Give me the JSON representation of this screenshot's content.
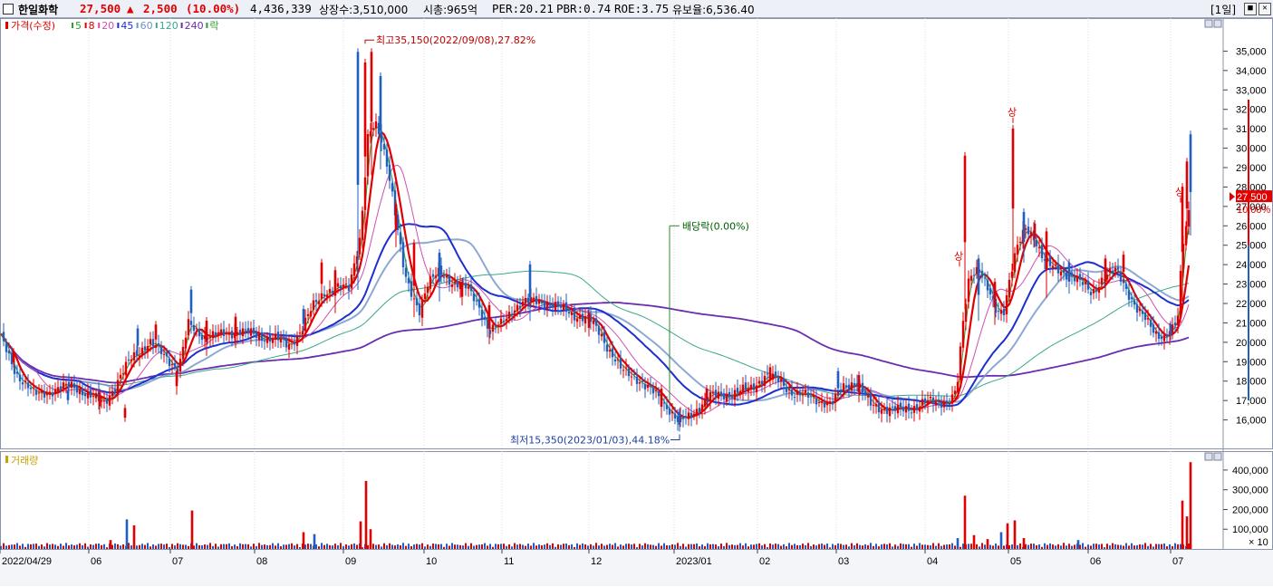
{
  "header": {
    "stock_name": "한일화학",
    "price": "27,500",
    "change_arrow": "▲",
    "change": "2,500",
    "change_pct": "(10.00%)",
    "volume": "4,436,339",
    "listed_shares": "상장수:3,510,000",
    "market_cap": "시총:965억",
    "per": "PER:20.21",
    "pbr": "PBR:0.74",
    "roe": "ROE:3.75",
    "retention": "유보율:6,536.40",
    "period": "[1일]"
  },
  "colors": {
    "up": "#e00000",
    "down": "#1f5fbf",
    "ma5": "#2ca02c",
    "ma8": "#e00000",
    "ma20": "#d050b0",
    "ma45": "#1c2fd0",
    "ma60": "#6f93c8",
    "ma120": "#3aa88a",
    "ma240": "#6a2db0"
  },
  "chart_data": {
    "type": "candlestick",
    "price_panel": {
      "legend": [
        {
          "label": "가격(수정)",
          "color": "#e00000"
        },
        {
          "label": "5",
          "color": "#2ca02c"
        },
        {
          "label": "8",
          "color": "#e00000"
        },
        {
          "label": "20",
          "color": "#d050b0"
        },
        {
          "label": "45",
          "color": "#1c2fd0"
        },
        {
          "label": "60",
          "color": "#6f93c8"
        },
        {
          "label": "120",
          "color": "#3aa88a"
        },
        {
          "label": "240",
          "color": "#6a2db0"
        },
        {
          "label": "락",
          "color": "#2ca02c"
        }
      ],
      "y_ticks": [
        "16,000",
        "17,000",
        "18,000",
        "19,000",
        "20,000",
        "21,000",
        "22,000",
        "23,000",
        "24,000",
        "25,000",
        "26,000",
        "27,000",
        "28,000",
        "29,000",
        "30,000",
        "31,000",
        "32,000",
        "33,000",
        "34,000",
        "35,000"
      ],
      "ylim": [
        15000,
        36000
      ],
      "current_price_label": "27,500",
      "current_pct_label": "10.00%",
      "annotations": {
        "high": "최고35,150(2022/09/08),27.82%",
        "low": "최저15,350(2023/01/03),44.18%",
        "dividend": "배당락(0.00%)",
        "limit_up": "상"
      }
    },
    "volume_panel": {
      "label": "거래량",
      "y_ticks": [
        "100,000",
        "200,000",
        "300,000",
        "400,000"
      ],
      "ylim": [
        0,
        450000
      ],
      "unit": "× 10"
    },
    "x_labels": [
      "2022/04/29",
      "06",
      "07",
      "08",
      "09",
      "10",
      "11",
      "12",
      "2023/01",
      "02",
      "03",
      "04",
      "05",
      "06",
      "07"
    ],
    "keypoints": [
      [
        0,
        20300
      ],
      [
        18,
        18400
      ],
      [
        38,
        17300
      ],
      [
        58,
        17500
      ],
      [
        80,
        17800
      ],
      [
        100,
        17200
      ],
      [
        115,
        16900
      ],
      [
        128,
        17800
      ],
      [
        145,
        19200
      ],
      [
        165,
        20000
      ],
      [
        182,
        19300
      ],
      [
        197,
        18600
      ],
      [
        208,
        20900
      ],
      [
        225,
        20300
      ],
      [
        245,
        20400
      ],
      [
        265,
        20600
      ],
      [
        285,
        20300
      ],
      [
        305,
        20200
      ],
      [
        318,
        19800
      ],
      [
        332,
        20600
      ],
      [
        345,
        21800
      ],
      [
        358,
        22600
      ],
      [
        372,
        22800
      ],
      [
        385,
        22800
      ],
      [
        398,
        25600
      ],
      [
        406,
        30500
      ],
      [
        414,
        31200
      ],
      [
        421,
        30400
      ],
      [
        427,
        29300
      ],
      [
        433,
        27700
      ],
      [
        440,
        25400
      ],
      [
        447,
        23300
      ],
      [
        455,
        22400
      ],
      [
        463,
        21700
      ],
      [
        472,
        23000
      ],
      [
        485,
        23600
      ],
      [
        500,
        23100
      ],
      [
        515,
        22800
      ],
      [
        528,
        22000
      ],
      [
        540,
        20500
      ],
      [
        552,
        20900
      ],
      [
        565,
        21700
      ],
      [
        578,
        22000
      ],
      [
        590,
        22200
      ],
      [
        600,
        22100
      ],
      [
        612,
        21800
      ],
      [
        625,
        21700
      ],
      [
        638,
        21300
      ],
      [
        652,
        21100
      ],
      [
        663,
        20500
      ],
      [
        673,
        19500
      ],
      [
        685,
        18600
      ],
      [
        700,
        18300
      ],
      [
        712,
        17700
      ],
      [
        725,
        17300
      ],
      [
        738,
        16600
      ],
      [
        748,
        15900
      ],
      [
        758,
        16100
      ],
      [
        770,
        16600
      ],
      [
        783,
        17200
      ],
      [
        798,
        17300
      ],
      [
        812,
        17400
      ],
      [
        828,
        17600
      ],
      [
        845,
        18300
      ],
      [
        860,
        18000
      ],
      [
        875,
        17400
      ],
      [
        890,
        17200
      ],
      [
        905,
        17000
      ],
      [
        918,
        16800
      ],
      [
        930,
        17700
      ],
      [
        945,
        18000
      ],
      [
        960,
        16800
      ],
      [
        975,
        16600
      ],
      [
        990,
        16500
      ],
      [
        1005,
        16600
      ],
      [
        1020,
        16900
      ],
      [
        1035,
        16900
      ],
      [
        1048,
        17000
      ],
      [
        1056,
        17500
      ],
      [
        1063,
        21000
      ],
      [
        1070,
        23500
      ],
      [
        1080,
        23900
      ],
      [
        1090,
        22700
      ],
      [
        1100,
        21500
      ],
      [
        1108,
        21700
      ],
      [
        1115,
        23500
      ],
      [
        1122,
        24800
      ],
      [
        1132,
        25800
      ],
      [
        1142,
        25400
      ],
      [
        1152,
        24300
      ],
      [
        1162,
        23800
      ],
      [
        1172,
        23600
      ],
      [
        1182,
        23500
      ],
      [
        1192,
        23100
      ],
      [
        1205,
        22500
      ],
      [
        1218,
        23400
      ],
      [
        1232,
        23700
      ],
      [
        1245,
        22600
      ],
      [
        1255,
        21700
      ],
      [
        1265,
        21100
      ],
      [
        1275,
        20500
      ],
      [
        1285,
        20300
      ],
      [
        1295,
        20700
      ],
      [
        1300,
        21200
      ],
      [
        1305,
        25000
      ],
      [
        1310,
        26200
      ],
      [
        1314,
        27500
      ]
    ],
    "spikes": [
      [
        15,
        19700,
        18700
      ],
      [
        75,
        17700,
        16800
      ],
      [
        110,
        17600,
        16300
      ],
      [
        138,
        16800,
        15900
      ],
      [
        152,
        20900,
        19300
      ],
      [
        172,
        21100,
        19700
      ],
      [
        195,
        18700,
        17300
      ],
      [
        211,
        22900,
        20700
      ],
      [
        228,
        21300,
        19300
      ],
      [
        260,
        21500,
        19700
      ],
      [
        335,
        21900,
        20500
      ],
      [
        355,
        24300,
        22300
      ],
      [
        370,
        23900,
        21500
      ],
      [
        395,
        35150,
        22700
      ],
      [
        403,
        34600,
        25800
      ],
      [
        410,
        35150,
        28600
      ],
      [
        420,
        33900,
        28900
      ],
      [
        437,
        27300,
        24900
      ],
      [
        457,
        25300,
        21300
      ],
      [
        485,
        24800,
        22100
      ],
      [
        510,
        23300,
        21900
      ],
      [
        540,
        22100,
        19900
      ],
      [
        585,
        24200,
        21100
      ],
      [
        650,
        21700,
        20300
      ],
      [
        730,
        17800,
        16100
      ],
      [
        750,
        16600,
        15400
      ],
      [
        780,
        17800,
        16700
      ],
      [
        850,
        18900,
        17700
      ],
      [
        925,
        18700,
        17100
      ],
      [
        948,
        18500,
        16900
      ],
      [
        1065,
        29800,
        21700
      ],
      [
        1080,
        24500,
        21100
      ],
      [
        1098,
        23300,
        20900
      ],
      [
        1118,
        31200,
        23700
      ],
      [
        1130,
        26900,
        24100
      ],
      [
        1142,
        26300,
        24900
      ],
      [
        1155,
        25900,
        22300
      ],
      [
        1180,
        24300,
        22500
      ],
      [
        1220,
        24500,
        22300
      ],
      [
        1240,
        24700,
        23100
      ],
      [
        1292,
        21100,
        20100
      ],
      [
        1305,
        28200,
        22100
      ],
      [
        1310,
        29500,
        25100
      ],
      [
        1314,
        30900,
        25500
      ]
    ],
    "volume_spikes": [
      [
        122,
        45000
      ],
      [
        140,
        150000
      ],
      [
        148,
        120000
      ],
      [
        212,
        195000
      ],
      [
        335,
        85000
      ],
      [
        347,
        75000
      ],
      [
        398,
        140000
      ],
      [
        404,
        345000
      ],
      [
        409,
        100000
      ],
      [
        1057,
        55000
      ],
      [
        1065,
        270000
      ],
      [
        1075,
        70000
      ],
      [
        1090,
        50000
      ],
      [
        1105,
        85000
      ],
      [
        1112,
        130000
      ],
      [
        1120,
        145000
      ],
      [
        1130,
        55000
      ],
      [
        1190,
        45000
      ],
      [
        1305,
        245000
      ],
      [
        1310,
        165000
      ],
      [
        1314,
        440000
      ]
    ]
  }
}
